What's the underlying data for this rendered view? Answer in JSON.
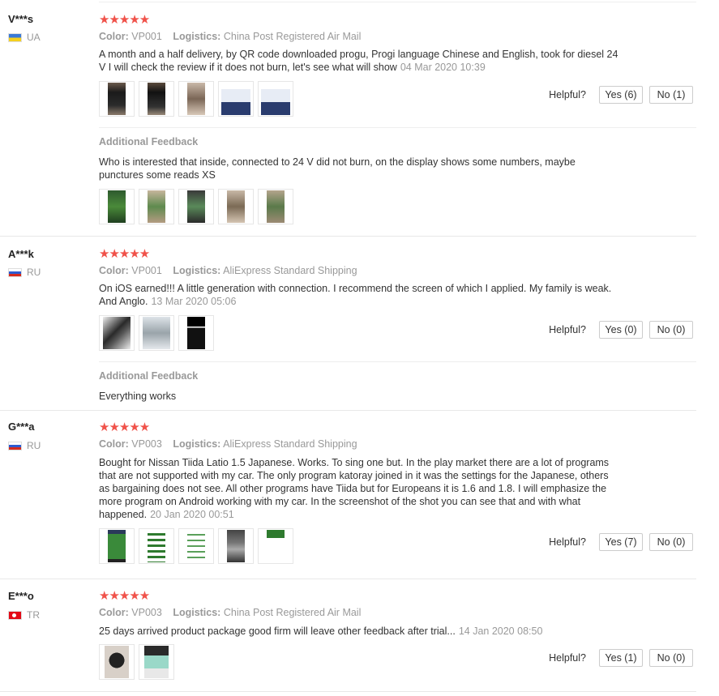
{
  "helpful_label": "Helpful?",
  "color_label": "Color:",
  "logistics_label": "Logistics:",
  "additional_feedback_label": "Additional Feedback",
  "star_color": "#f0524a",
  "reviews": [
    {
      "user": "V***s",
      "country": "UA",
      "stars": "★★★★★",
      "color": "VP001",
      "logistics": "China Post Registered Air Mail",
      "text": "A month and a half delivery, by QR code downloaded progu, Progi language Chinese and English, took for diesel 24 V I will check the review if it does not burn, let's see what will show",
      "date": "04 Mar 2020 10:39",
      "yes": "Yes (6)",
      "no": "No (1)",
      "additional": "Who is interested that inside, connected to 24 V did not burn, on the display shows some numbers, maybe punctures some reads XS"
    },
    {
      "user": "A***k",
      "country": "RU",
      "stars": "★★★★★",
      "color": "VP001",
      "logistics": "AliExpress Standard Shipping",
      "text": "On iOS earned!!! A little generation with connection. I recommend the screen of which I applied. My family is weak. And Anglo.",
      "date": "13 Mar 2020 05:06",
      "yes": "Yes (0)",
      "no": "No (0)",
      "additional": "Everything works"
    },
    {
      "user": "G***a",
      "country": "RU",
      "stars": "★★★★★",
      "color": "VP003",
      "logistics": "AliExpress Standard Shipping",
      "text": "Bought for Nissan Tiida Latio 1.5 Japanese. Works. To sing one but. In the play market there are a lot of programs that are not supported with my car. The only program katoray joined in it was the settings for the Japanese, others as bargaining does not see. All other programs have Tiida but for Europeans it is 1.6 and 1.8. I will emphasize the more program on Android working with my car. In the screenshot of the shot you can see that and with what happened.",
      "date": "20 Jan 2020 00:51",
      "yes": "Yes (7)",
      "no": "No (0)"
    },
    {
      "user": "E***o",
      "country": "TR",
      "stars": "★★★★★",
      "color": "VP003",
      "logistics": "China Post Registered Air Mail",
      "text": "25 days arrived product package good firm will leave other feedback after trial...",
      "date": "14 Jan 2020 08:50",
      "yes": "Yes (1)",
      "no": "No (0)"
    }
  ]
}
